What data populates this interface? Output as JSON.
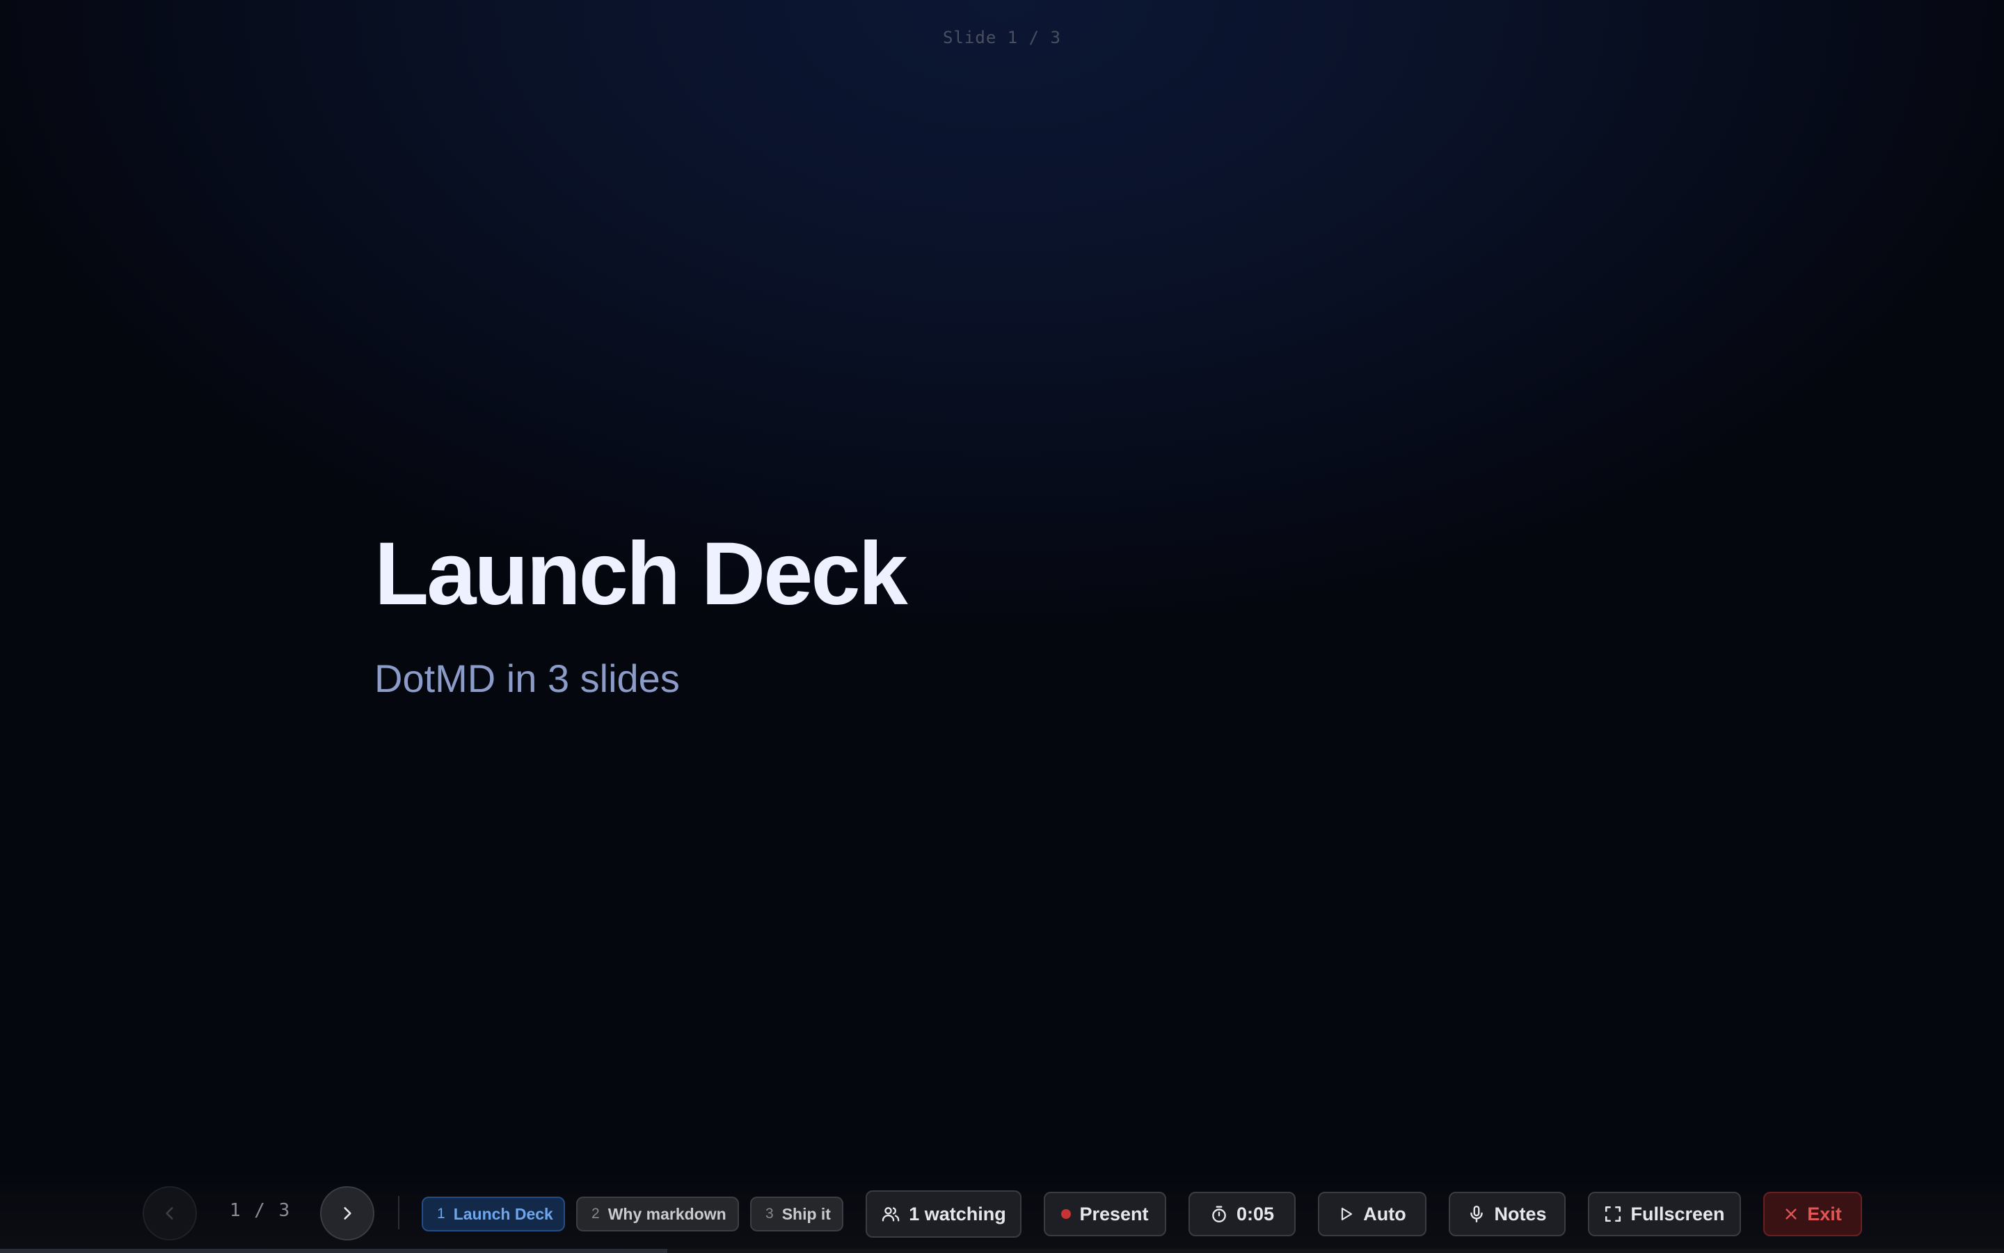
{
  "slide_indicator": "Slide 1 / 3",
  "slide": {
    "title": "Launch Deck",
    "subtitle": "DotMD in 3 slides"
  },
  "nav": {
    "counter": "1 / 3",
    "prev_icon": "chevron-left-icon",
    "next_icon": "chevron-right-icon"
  },
  "chips": [
    {
      "num": "1",
      "label": "Launch Deck",
      "active": true
    },
    {
      "num": "2",
      "label": "Why markdown",
      "active": false
    },
    {
      "num": "3",
      "label": "Ship it",
      "active": false
    }
  ],
  "controls": {
    "watching": "1 watching",
    "present": "Present",
    "timer": "0:05",
    "auto": "Auto",
    "notes": "Notes",
    "fullscreen": "Fullscreen",
    "exit": "Exit"
  },
  "progress": {
    "fraction": 0.333
  },
  "colors": {
    "accent": "#6fa5ea",
    "record": "#c83434",
    "exit": "#e25555"
  }
}
